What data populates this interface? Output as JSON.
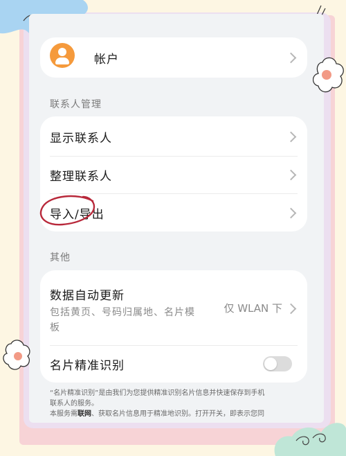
{
  "account": {
    "label": "帐户"
  },
  "sections": {
    "contacts_management": "联系人管理",
    "others": "其他"
  },
  "contacts_items": [
    {
      "label": "显示联系人"
    },
    {
      "label": "整理联系人"
    },
    {
      "label": "导入/导出"
    }
  ],
  "auto_update": {
    "title": "数据自动更新",
    "subtitle_line1": "包括黄页、号码归属地、名片模",
    "subtitle_line2": "板",
    "value": "仅 WLAN 下"
  },
  "card_recognition": {
    "label": "名片精准识别",
    "enabled": false
  },
  "footnote": {
    "line1": "“名片精准识别”是由我们为您提供精准识别名片信息并快速保存到手机",
    "line2": "联系人的服务。",
    "line3_a": "本服务需",
    "line3_bold": "联网",
    "line3_b": "、获取名片信息用于精准地识别。打开开关，即表示您同"
  },
  "colors": {
    "avatar": "#f59a3c",
    "annotation_circle": "#b8283a",
    "background": "#f1f3f5"
  }
}
